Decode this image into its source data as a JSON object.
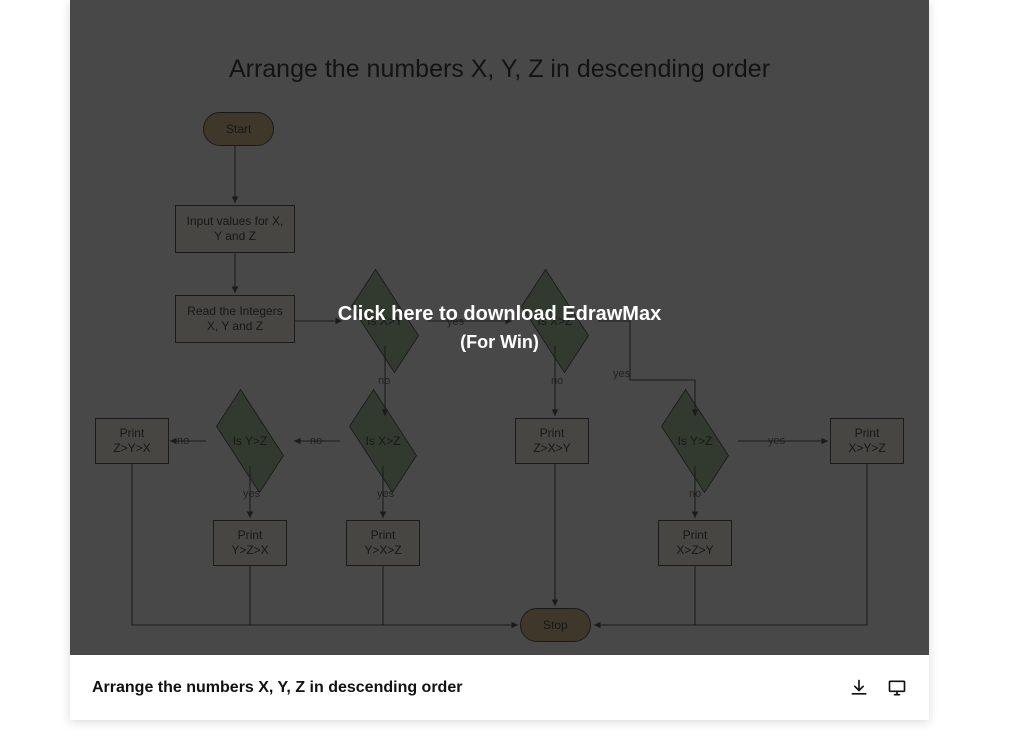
{
  "title": "Arrange the numbers X, Y, Z in descending order",
  "footer": {
    "title": "Arrange the numbers X, Y, Z in descending order"
  },
  "overlay": {
    "line1": "Click here to download EdrawMax",
    "line2": "(For Win)"
  },
  "nodes": {
    "start": "Start",
    "input": "Input values for X, Y and Z",
    "read": "Read the Integers X, Y and Z",
    "dec_xy": "Is X>Y",
    "dec_xz_top": "Is X>Z",
    "dec_yz_left": "Is Y>Z",
    "dec_xz_mid": "Is X>Z",
    "dec_yz_right": "Is Y>Z",
    "print_zyx": "Print\nZ>Y>X",
    "print_zxy": "Print\nZ>X>Y",
    "print_yzx": "Print\nY>Z>X",
    "print_yxz": "Print\nY>X>Z",
    "print_xzy": "Print\nX>Z>Y",
    "print_xyz": "Print\nX>Y>Z",
    "stop": "Stop"
  },
  "labels": {
    "yes": "yes",
    "no": "no"
  },
  "icons": {
    "download": "download-icon",
    "preview": "preview-icon"
  }
}
